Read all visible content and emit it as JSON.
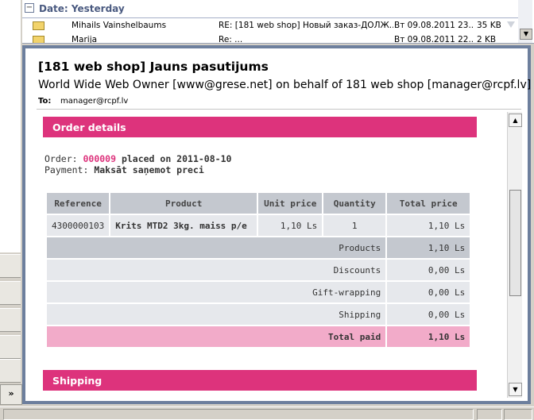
{
  "message_list": {
    "group_label": "Date: Yesterday",
    "group_toggle": "−",
    "rows": [
      {
        "from": "Mihails Vainshelbaums",
        "subject": "RE: [181 web shop] Новый заказ-ДОЛЖ...",
        "received": "Вт 09.08.2011 23...",
        "size": "35 KB"
      },
      {
        "from": "Marija",
        "subject": "Re: ...",
        "received": "Вт 09.08.2011 22...",
        "size": "2 KB"
      }
    ]
  },
  "reading_pane": {
    "subject": "[181 web shop] Jauns pasutijums",
    "from": "World Wide Web Owner [www@grese.net] on behalf of 181 web shop [manager@rcpf.lv]",
    "to_label": "To:",
    "to_value": "manager@rcpf.lv"
  },
  "email": {
    "order_section_title": "Order details",
    "order_prefix": "Order: ",
    "order_ref": "000009",
    "order_placed": " placed on 2011-08-10",
    "payment_label": "Payment: ",
    "payment_value": "Maksāt saņemot preci",
    "table_headers": [
      "Reference",
      "Product",
      "Unit price",
      "Quantity",
      "Total price"
    ],
    "item": {
      "reference": "4300000103",
      "product": "Krits MTD2 3kg. maiss p/e",
      "unit_price": "1,10 Ls",
      "quantity": "1",
      "total_price": "1,10 Ls"
    },
    "summary": [
      {
        "label": "Products",
        "value": "1,10 Ls"
      },
      {
        "label": "Discounts",
        "value": "0,00 Ls"
      },
      {
        "label": "Gift-wrapping",
        "value": "0,00 Ls"
      },
      {
        "label": "Shipping",
        "value": "0,00 Ls"
      }
    ],
    "total_label": "Total paid",
    "total_value": "1,10 Ls",
    "shipping_section_title": "Shipping"
  },
  "left_pane": {
    "expand_glyph": "»"
  },
  "colors": {
    "accent": "#dd337c",
    "accent_light": "#f2abc9",
    "table_header": "#c4c8cf",
    "table_cell": "#e6e8ec"
  }
}
